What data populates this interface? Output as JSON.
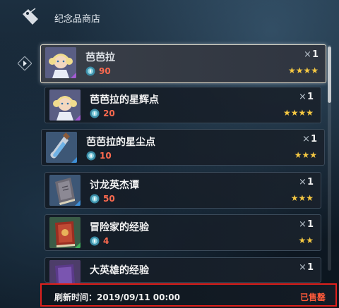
{
  "header": {
    "title": "纪念品商店"
  },
  "items": [
    {
      "name": "芭芭拉",
      "price": "90",
      "qty_prefix": "×",
      "qty": "1",
      "stars": "★★★★",
      "rarity_color": "#a25bd1"
    },
    {
      "name": "芭芭拉的星辉点",
      "price": "20",
      "qty_prefix": "×",
      "qty": "1",
      "stars": "★★★★",
      "rarity_color": "#a25bd1"
    },
    {
      "name": "芭芭拉的星尘点",
      "price": "10",
      "qty_prefix": "×",
      "qty": "1",
      "stars": "★★★",
      "rarity_color": "#3e8fd6"
    },
    {
      "name": "讨龙英杰谭",
      "price": "50",
      "qty_prefix": "×",
      "qty": "1",
      "stars": "★★★",
      "rarity_color": "#3e8fd6"
    },
    {
      "name": "冒险家的经验",
      "price": "4",
      "qty_prefix": "×",
      "qty": "1",
      "stars": "★★",
      "rarity_color": "#3fae5a"
    },
    {
      "name": "大英雄的经验",
      "price": "",
      "qty_prefix": "×",
      "qty": "1",
      "stars": "",
      "rarity_color": "#a25bd1"
    }
  ],
  "footer": {
    "refresh": "刷新时间：2019/09/11 00:00",
    "status": "已售罄"
  },
  "colors": {
    "price": "#ff6a4f",
    "stars": "#f5c842",
    "highlight_border": "#e0201c"
  },
  "icons": [
    "tag-icon",
    "chevron-right-icon",
    "coin-icon"
  ]
}
